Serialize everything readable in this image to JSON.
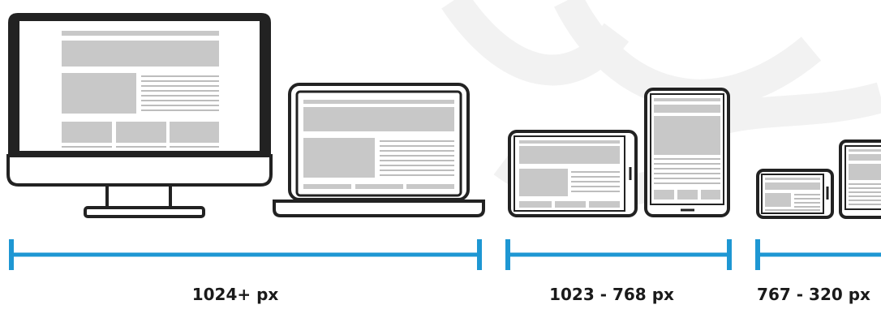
{
  "colors": {
    "outline": "#222222",
    "screen_fill": "#ffffff",
    "block": "#c8c8c8",
    "line": "#bdbdbd",
    "ruler": "#1e97d3",
    "watermark": "#f3f3f3"
  },
  "breakpoints": [
    {
      "label": "1024+ px",
      "devices": [
        "desktop-monitor",
        "laptop"
      ]
    },
    {
      "label": "1023 - 768 px",
      "devices": [
        "tablet-landscape",
        "tablet-portrait"
      ]
    },
    {
      "label": "767 - 320 px",
      "devices": [
        "phone-landscape",
        "phone-portrait"
      ]
    }
  ]
}
